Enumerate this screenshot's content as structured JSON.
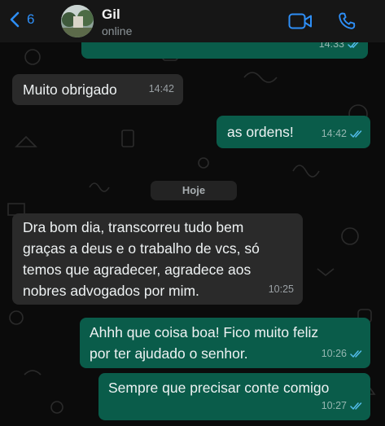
{
  "header": {
    "back_count": "6",
    "contact_name": "Gil",
    "contact_status": "online"
  },
  "date_separator": "Hoje",
  "messages": [
    {
      "direction": "out",
      "text": "",
      "time": "14:33",
      "status": "read"
    },
    {
      "direction": "in",
      "text": "Muito obrigado",
      "time": "14:42"
    },
    {
      "direction": "out",
      "text": "as ordens!",
      "time": "14:42",
      "status": "read"
    },
    {
      "direction": "in",
      "text": "Dra bom dia, transcorreu tudo bem\ngraças a deus e o trabalho de vcs, só\ntemos que agradecer, agradece aos\nnobres advogados por mim.",
      "time": "10:25"
    },
    {
      "direction": "out",
      "text": "Ahhh que coisa boa! Fico muito feliz\npor ter ajudado o senhor.",
      "time": "10:26",
      "status": "read"
    },
    {
      "direction": "out",
      "text": "Sempre que precisar conte comigo",
      "time": "10:27",
      "status": "read"
    }
  ],
  "colors": {
    "accent": "#2e8ff7",
    "outgoing_bubble": "#0a5c4a",
    "incoming_bubble": "#2a2a2a",
    "read_ticks": "#53bdeb"
  },
  "icons": [
    "chevron-left-icon",
    "video-call-icon",
    "phone-icon",
    "double-check-icon"
  ]
}
